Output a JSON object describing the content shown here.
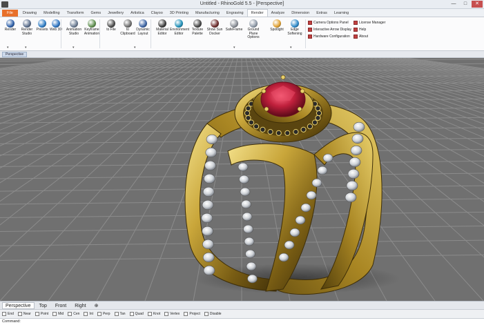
{
  "window": {
    "title": "Untitled - RhinoGold 5.5 - [Perspective]",
    "minimize": "—",
    "maximize": "□",
    "close": "✕"
  },
  "tabs": [
    "File",
    "Drawing",
    "Modelling",
    "Transform",
    "Gems",
    "Jewellery",
    "Artistica",
    "Clayoo",
    "3D Printing",
    "Manufacturing",
    "Engraving",
    "Render",
    "Analyze",
    "Dimension",
    "Extras",
    "Learning"
  ],
  "active_tab": "Render",
  "ribbon": {
    "buttons": [
      {
        "label": "Render",
        "icon": "render-sphere-icon",
        "color": "#2d5fa8"
      },
      {
        "label": "Render Studio",
        "icon": "render-studio-icon",
        "color": "#5b6e8c"
      },
      {
        "label": "Presets",
        "icon": "presets-icon",
        "color": "#2c7bc4"
      },
      {
        "label": "Web 3D",
        "icon": "web3d-globe-icon",
        "color": "#2a72c0"
      },
      {
        "label": "Animation Studio",
        "icon": "animation-studio-icon",
        "color": "#6a7b92"
      },
      {
        "label": "Keyframe Animation",
        "icon": "keyframe-icon",
        "color": "#5e8f4e"
      },
      {
        "label": "to File",
        "icon": "to-file-icon",
        "color": "#4b4b4b"
      },
      {
        "label": "to Clipboard",
        "icon": "clipboard-icon",
        "color": "#6c6c6c"
      },
      {
        "label": "Dynamic Layout",
        "icon": "dynamic-layout-icon",
        "color": "#3c64a4"
      },
      {
        "label": "Material Editor",
        "icon": "material-editor-icon",
        "color": "#3a3a3a"
      },
      {
        "label": "Environment Editor",
        "icon": "environment-editor-icon",
        "color": "#1e8fb8"
      },
      {
        "label": "Texture Palette",
        "icon": "texture-palette-icon",
        "color": "#444444"
      },
      {
        "label": "Show Sun Docker",
        "icon": "sun-docker-icon",
        "color": "#6b2a2a"
      },
      {
        "label": "SafeFrame",
        "icon": "safeframe-icon",
        "color": "#8a8f97"
      },
      {
        "label": "Ground Plane Options",
        "icon": "ground-plane-icon",
        "color": "#8f9aa8"
      },
      {
        "label": "Spotlight",
        "icon": "spotlight-icon",
        "color": "#e0a030"
      },
      {
        "label": "Edge Softening",
        "icon": "edge-softening-icon",
        "color": "#2a86c6"
      }
    ],
    "list_group_1": [
      "Camera Options Panel",
      "Interactive Arrow Display",
      "Hardware Configuration"
    ],
    "list_group_2": [
      "License Manager",
      "Help",
      "About"
    ],
    "group_arrow": "▾"
  },
  "viewport": {
    "tab_label": "Perspective",
    "grid_color": "#8a8a8a",
    "background_color": "#6f6f6f",
    "gold_color": "#c9a63a",
    "ruby_color": "#c0203c"
  },
  "view_tabs": [
    "Perspective",
    "Top",
    "Front",
    "Right",
    "⊕"
  ],
  "osnaps": [
    "End",
    "Near",
    "Point",
    "Mid",
    "Cen",
    "Int",
    "Perp",
    "Tan",
    "Quad",
    "Knot",
    "Vertex",
    "Project",
    "Disable"
  ],
  "command": {
    "label": "Command:"
  }
}
